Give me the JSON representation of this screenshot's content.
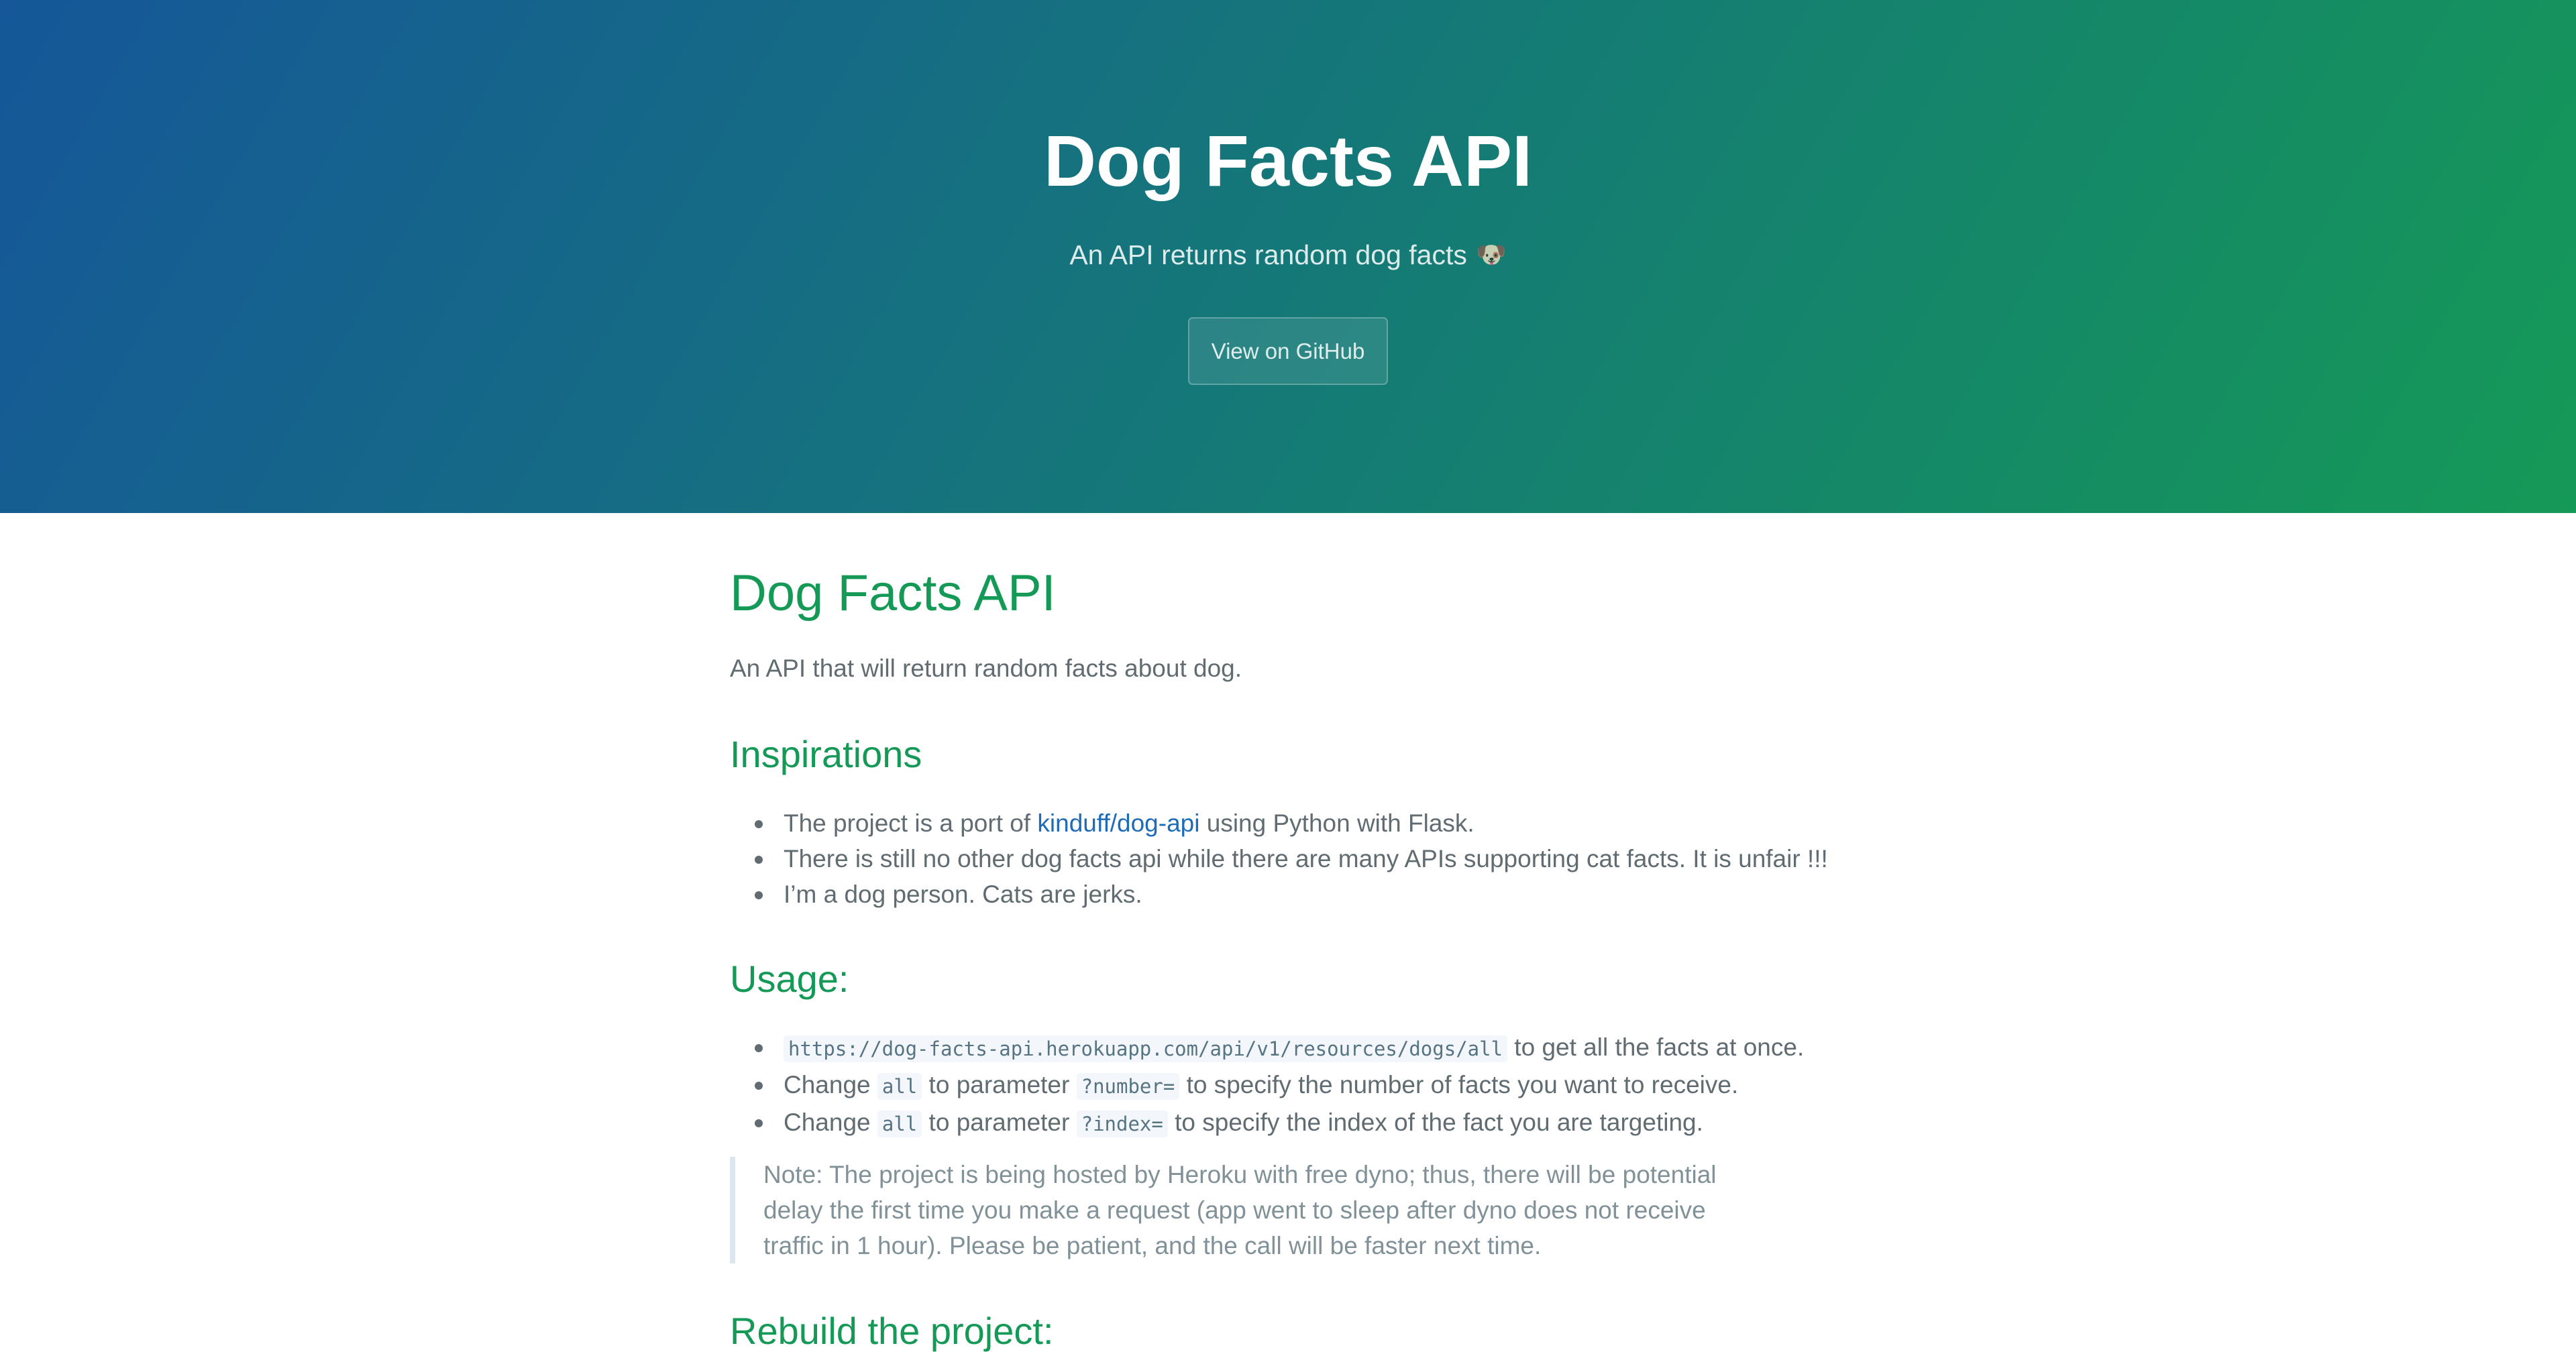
{
  "header": {
    "title": "Dog Facts API",
    "tagline": "An API returns random dog facts",
    "tagline_icon": "dog-face-icon",
    "github_button": "View on GitHub"
  },
  "main": {
    "title": "Dog Facts API",
    "intro": "An API that will return random facts about dog.",
    "inspirations": {
      "heading": "Inspirations",
      "item1": {
        "before": "The project is a port of ",
        "link": "kinduff/dog-api",
        "after": " using Python with Flask."
      },
      "item2": "There is still no other dog facts api while there are many APIs supporting cat facts. It is unfair !!!",
      "item3": "I’m a dog person. Cats are jerks."
    },
    "usage": {
      "heading": "Usage:",
      "item1": {
        "code": "https://dog-facts-api.herokuapp.com/api/v1/resources/dogs/all",
        "after": " to get all the facts at once."
      },
      "item2": {
        "before": "Change ",
        "code1": "all",
        "middle": " to parameter ",
        "code2": "?number=",
        "after": " to specify the number of facts you want to receive."
      },
      "item3": {
        "before": "Change ",
        "code1": "all",
        "middle": " to parameter ",
        "code2": "?index=",
        "after": " to specify the index of the fact you are targeting."
      }
    },
    "note": {
      "line1": "Note: The project is being hosted by Heroku with free dyno; thus, there will be potential",
      "line2": "delay the first time you make a request (app went to sleep after dyno does not receive",
      "line3": "traffic in 1 hour). Please be patient, and the call will be faster next time."
    },
    "rebuild_heading": "Rebuild the project:"
  },
  "colors": {
    "header_gradient_start": "#155799",
    "header_gradient_end": "#159957",
    "heading_green": "#159957",
    "link_blue": "#1e6bb8",
    "body_text": "#606c71"
  }
}
